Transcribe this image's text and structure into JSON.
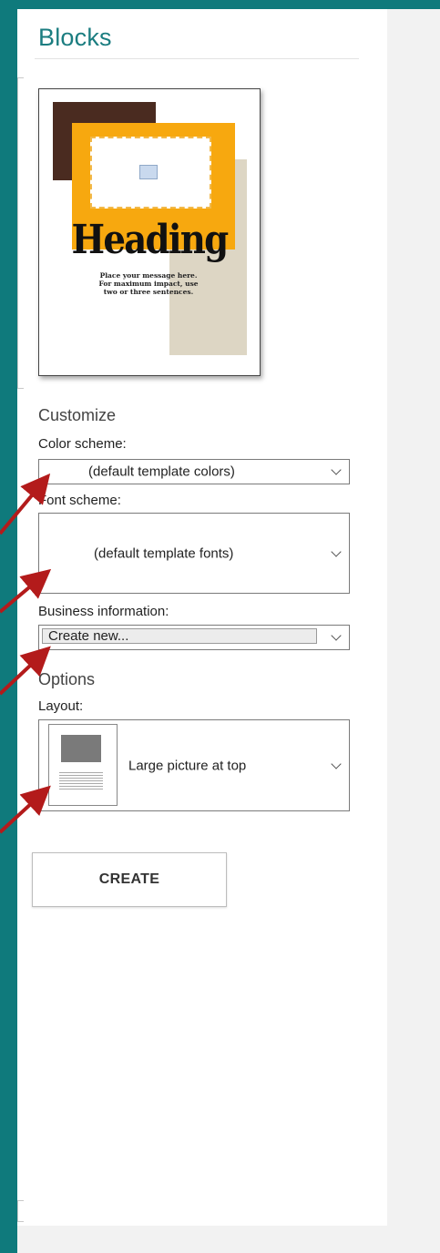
{
  "panel": {
    "title": "Blocks"
  },
  "preview": {
    "heading": "Heading",
    "body_line1": "Place your message here.",
    "body_line2": "For maximum impact, use",
    "body_line3": "two or three sentences."
  },
  "customize": {
    "section_label": "Customize",
    "color_scheme_label": "Color scheme:",
    "color_scheme_value": "(default template colors)",
    "font_scheme_label": "Font scheme:",
    "font_scheme_value": "(default template fonts)",
    "business_info_label": "Business information:",
    "business_info_value": "Create new..."
  },
  "options": {
    "section_label": "Options",
    "layout_label": "Layout:",
    "layout_value": "Large picture at top"
  },
  "actions": {
    "create_label": "CREATE"
  },
  "colors": {
    "accent_teal": "#0f7a7c",
    "arrow_red": "#b31b1b",
    "preview_orange": "#f7a80f",
    "preview_brown": "#4a2b20",
    "preview_beige": "#ddd6c4"
  }
}
